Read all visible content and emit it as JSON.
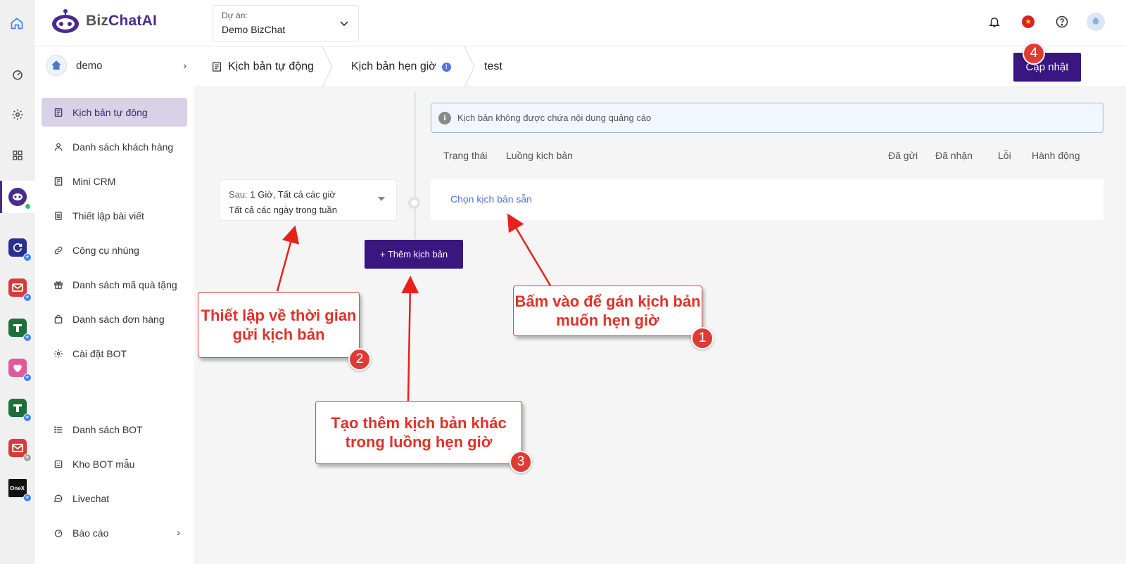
{
  "header": {
    "logo_text_a": "Biz",
    "logo_text_b": "ChatAI",
    "project_caption": "Dự án:",
    "project_value": "Demo BizChat",
    "icons": [
      "bell-icon",
      "vietnam-flag-icon",
      "help-icon",
      "user-avatar-icon"
    ]
  },
  "rail": {
    "icons": [
      "home-icon",
      "dashboard-icon",
      "settings-icon",
      "apps-grid-icon",
      "bizchat-bot-icon",
      "app-sync-icon",
      "app-mail-icon",
      "app-tiki-icon",
      "app-heart-icon",
      "app-tiki-icon-2",
      "app-mail-icon-2",
      "app-onex-icon"
    ],
    "onex_label": "OneX"
  },
  "sidebar": {
    "account_name": "demo",
    "items": [
      {
        "label": "Kịch bản tự động",
        "icon": "script-icon",
        "active": true
      },
      {
        "label": "Danh sách khách hàng",
        "icon": "user-icon"
      },
      {
        "label": "Mini CRM",
        "icon": "crm-icon"
      },
      {
        "label": "Thiết lập bài viết",
        "icon": "post-icon"
      },
      {
        "label": "Công cụ nhúng",
        "icon": "link-icon"
      },
      {
        "label": "Danh sách mã quà tặng",
        "icon": "gift-icon"
      },
      {
        "label": "Danh sách đơn hàng",
        "icon": "bag-icon"
      },
      {
        "label": "Cài đặt BOT",
        "icon": "gear-icon"
      },
      {
        "label": "Danh sách BOT",
        "icon": "list-icon"
      },
      {
        "label": "Kho BOT mẫu",
        "icon": "bot-template-icon"
      },
      {
        "label": "Livechat",
        "icon": "chat-icon"
      },
      {
        "label": "Báo cáo",
        "icon": "report-icon"
      }
    ]
  },
  "breadcrumb": {
    "items": [
      "Kịch bản tự động",
      "Kịch bản hẹn giờ",
      "test"
    ],
    "info_mark": "!"
  },
  "toolbar": {
    "update_label": "Cập nhật"
  },
  "timer": {
    "after_label": "Sau:",
    "after_value": "1 Giờ, Tất cả các giờ",
    "days_value": "Tất cả các ngày trong tuần"
  },
  "add_button_label": "+ Thêm kịch bản",
  "notice": {
    "icon_char": "i",
    "text": "Kịch bản không được chứa nội dung quảng cáo"
  },
  "table": {
    "headers": [
      "Trạng thái",
      "Luồng kịch bản",
      "Đã gửi",
      "Đã nhận",
      "Lỗi",
      "Hành động"
    ]
  },
  "flow": {
    "choose_link": "Chọn kịch bản sẵn"
  },
  "annotations": {
    "callout_1": "Bấm vào để gán kịch bản muốn hẹn giờ",
    "callout_2": "Thiết lập về thời gian gửi kịch bản",
    "callout_3": "Tạo thêm kịch bản khác trong luồng hẹn giờ",
    "n1": "1",
    "n2": "2",
    "n3": "3",
    "n4": "4",
    "color": "#e0312a"
  },
  "colors": {
    "primary": "#3a1681",
    "active_nav_bg": "#d9d1e6",
    "link": "#4d73d8"
  }
}
